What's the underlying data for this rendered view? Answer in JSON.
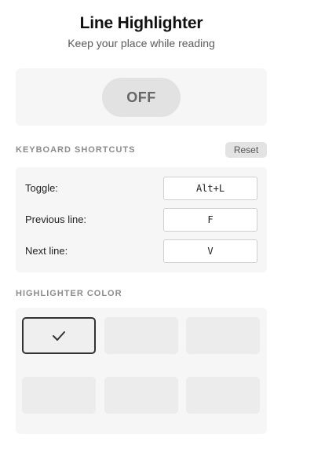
{
  "header": {
    "title": "Line Highlighter",
    "subtitle": "Keep your place while reading"
  },
  "toggle": {
    "state_label": "OFF"
  },
  "shortcuts": {
    "section_label": "KEYBOARD SHORTCUTS",
    "reset_label": "Reset",
    "rows": [
      {
        "label": "Toggle:",
        "value": "Alt+L"
      },
      {
        "label": "Previous line:",
        "value": "F"
      },
      {
        "label": "Next line:",
        "value": "V"
      }
    ]
  },
  "colors": {
    "section_label": "HIGHLIGHTER COLOR",
    "selected_index": 0,
    "swatches": [
      {
        "color": "#efefef",
        "icon": "check-icon"
      },
      {
        "color": "#ececec"
      },
      {
        "color": "#ececec"
      },
      {
        "color": "#ececec"
      },
      {
        "color": "#ececec"
      },
      {
        "color": "#ececec"
      }
    ]
  }
}
